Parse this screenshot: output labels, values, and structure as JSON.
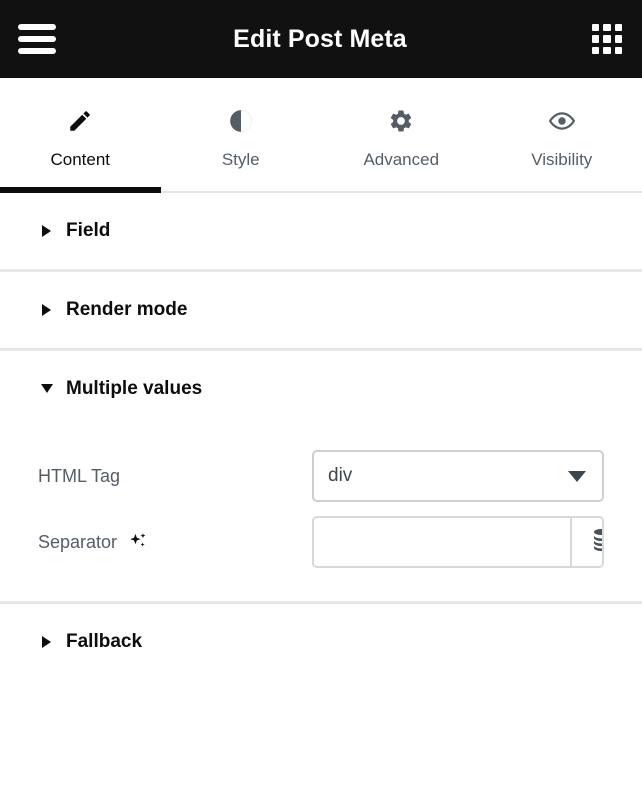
{
  "header": {
    "title": "Edit Post Meta",
    "menu_icon": "hamburger-menu-icon",
    "apps_icon": "apps-grid-icon"
  },
  "tabs": [
    {
      "label": "Content",
      "icon": "pencil-icon",
      "active": true
    },
    {
      "label": "Style",
      "icon": "contrast-icon",
      "active": false
    },
    {
      "label": "Advanced",
      "icon": "gear-icon",
      "active": false
    },
    {
      "label": "Visibility",
      "icon": "eye-icon",
      "active": false
    }
  ],
  "sections": [
    {
      "title": "Field",
      "expanded": false
    },
    {
      "title": "Render mode",
      "expanded": false
    },
    {
      "title": "Multiple values",
      "expanded": true
    },
    {
      "title": "Fallback",
      "expanded": false
    }
  ],
  "controls": {
    "html_tag": {
      "label": "HTML Tag",
      "value": "div",
      "caret_icon": "chevron-down-icon"
    },
    "separator": {
      "label": "Separator",
      "ai_icon": "sparkle-ai-icon",
      "value": "",
      "placeholder": "",
      "dynamic_icon": "database-icon"
    }
  },
  "colors": {
    "header_bg": "#111111",
    "accent": "#0c0d0e",
    "label": "#555d66",
    "border": "#ccd0d4",
    "divider": "#e7e7e7"
  }
}
